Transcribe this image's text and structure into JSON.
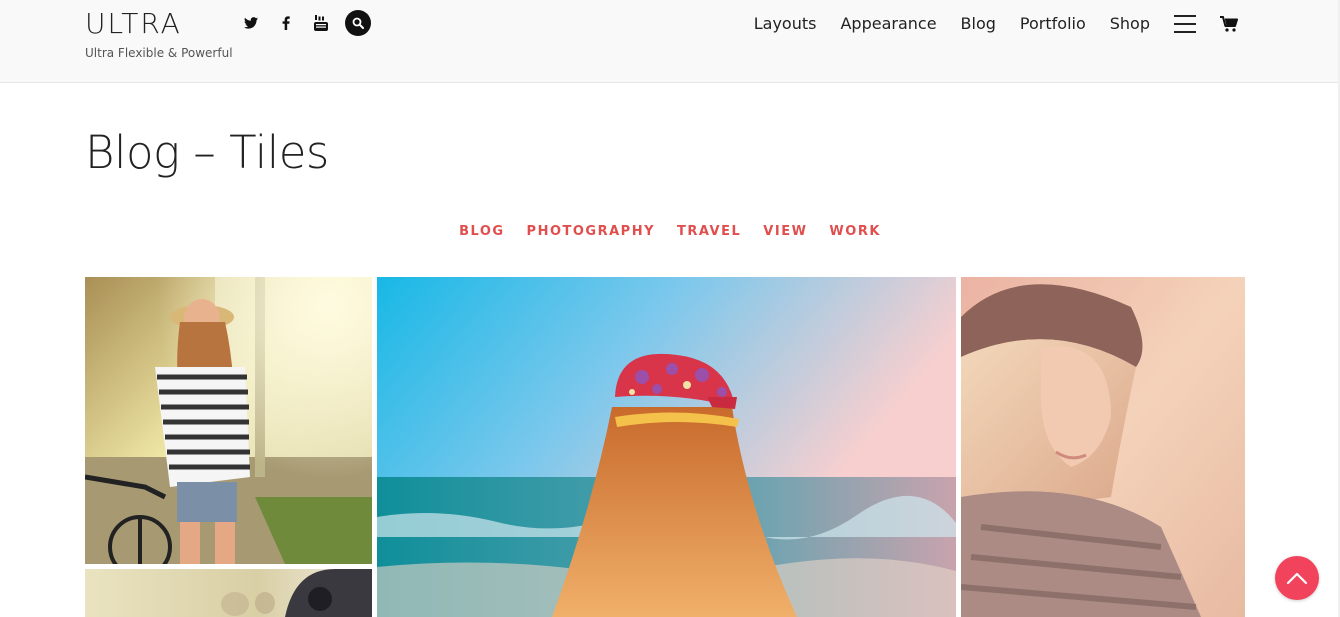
{
  "site": {
    "logo": "ULTRA",
    "tagline": "Ultra Flexible & Powerful"
  },
  "social": [
    {
      "icon": "twitter-icon"
    },
    {
      "icon": "facebook-icon"
    },
    {
      "icon": "youtube-icon"
    },
    {
      "icon": "search-icon"
    }
  ],
  "nav": {
    "items": [
      "Layouts",
      "Appearance",
      "Blog",
      "Portfolio",
      "Shop"
    ],
    "menu_icon": "hamburger-menu-icon",
    "cart_icon": "shopping-cart-icon"
  },
  "page": {
    "title": "Blog – Tiles"
  },
  "filters": [
    "BLOG",
    "PHOTOGRAPHY",
    "TRAVEL",
    "VIEW",
    "WORK"
  ],
  "colors": {
    "accent": "#e04e4e",
    "scroll_top": "#f1445c",
    "header_bg": "#f9f9f9"
  },
  "scroll_top_icon": "chevron-up-icon"
}
